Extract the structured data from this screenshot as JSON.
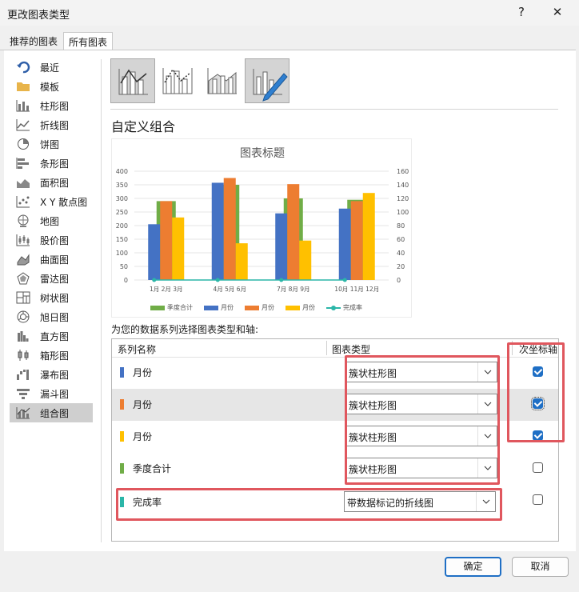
{
  "window": {
    "title": "更改图表类型",
    "help_label": "?",
    "close_label": "✕"
  },
  "tabs": [
    {
      "label": "推荐的图表",
      "active": false
    },
    {
      "label": "所有图表",
      "active": true
    }
  ],
  "sidebar": {
    "items": [
      {
        "label": "最近",
        "icon": "undo-arrow-icon"
      },
      {
        "label": "模板",
        "icon": "folder-icon"
      },
      {
        "label": "柱形图",
        "icon": "column-chart-icon"
      },
      {
        "label": "折线图",
        "icon": "line-chart-icon"
      },
      {
        "label": "饼图",
        "icon": "pie-chart-icon"
      },
      {
        "label": "条形图",
        "icon": "bar-chart-icon"
      },
      {
        "label": "面积图",
        "icon": "area-chart-icon"
      },
      {
        "label": "X Y 散点图",
        "icon": "scatter-chart-icon"
      },
      {
        "label": "地图",
        "icon": "map-chart-icon"
      },
      {
        "label": "股价图",
        "icon": "stock-chart-icon"
      },
      {
        "label": "曲面图",
        "icon": "surface-chart-icon"
      },
      {
        "label": "雷达图",
        "icon": "radar-chart-icon"
      },
      {
        "label": "树状图",
        "icon": "treemap-chart-icon"
      },
      {
        "label": "旭日图",
        "icon": "sunburst-chart-icon"
      },
      {
        "label": "直方图",
        "icon": "histogram-chart-icon"
      },
      {
        "label": "箱形图",
        "icon": "boxwhisker-chart-icon"
      },
      {
        "label": "瀑布图",
        "icon": "waterfall-chart-icon"
      },
      {
        "label": "漏斗图",
        "icon": "funnel-chart-icon"
      },
      {
        "label": "组合图",
        "icon": "combo-chart-icon",
        "selected": true
      }
    ]
  },
  "main": {
    "section_title": "自定义组合",
    "series_caption": "为您的数据系列选择图表类型和轴:",
    "table_headers": {
      "series_name": "系列名称",
      "chart_type": "图表类型",
      "secondary_axis": "次坐标轴"
    },
    "series": [
      {
        "name": "月份",
        "color": "#4472c4",
        "type": "簇状柱形图",
        "secondary": true
      },
      {
        "name": "月份",
        "color": "#ed7d31",
        "type": "簇状柱形图",
        "secondary": true
      },
      {
        "name": "月份",
        "color": "#ffc000",
        "type": "簇状柱形图",
        "secondary": true
      },
      {
        "name": "季度合计",
        "color": "#70ad47",
        "type": "簇状柱形图",
        "secondary": false
      },
      {
        "name": "完成率",
        "color": "#2bb6a8",
        "type": "带数据标记的折线图",
        "secondary": false
      }
    ]
  },
  "footer": {
    "ok_label": "确定",
    "cancel_label": "取消"
  },
  "accent_color": "#1f6fc5",
  "highlight_color": "#e0575e",
  "chart_data": {
    "type": "bar",
    "title": "图表标题",
    "categories": [
      "1月",
      "2月",
      "3月",
      "4月",
      "5月",
      "6月",
      "7月",
      "8月",
      "9月",
      "10月",
      "11月",
      "12月"
    ],
    "x_tick_label_groups": [
      "1月 2月 3月",
      "4月 5月 6月",
      "7月 8月 9月",
      "10月 11月 12月"
    ],
    "quarter_totals": {
      "name": "季度合计",
      "color": "#70ad47",
      "values": [
        290,
        350,
        300,
        295
      ]
    },
    "series": [
      {
        "name": "月份",
        "color": "#4472c4",
        "axis": "secondary",
        "values": [
          82,
          null,
          null,
          143,
          null,
          null,
          98,
          null,
          null,
          105,
          null,
          null
        ]
      },
      {
        "name": "月份",
        "color": "#ed7d31",
        "axis": "secondary",
        "values": [
          null,
          116,
          null,
          null,
          150,
          null,
          null,
          141,
          null,
          null,
          116,
          null
        ]
      },
      {
        "name": "月份",
        "color": "#ffc000",
        "axis": "secondary",
        "values": [
          null,
          null,
          92,
          null,
          null,
          54,
          null,
          null,
          58,
          null,
          null,
          128
        ]
      },
      {
        "name": "完成率",
        "color": "#2bb6a8",
        "type": "line",
        "axis": "secondary",
        "values": [
          0,
          null,
          null,
          0,
          null,
          null,
          0,
          null,
          null,
          0,
          null,
          null
        ]
      }
    ],
    "ylim": [
      0,
      400
    ],
    "yticks": [
      0,
      50,
      100,
      150,
      200,
      250,
      300,
      350,
      400
    ],
    "y2lim": [
      0,
      160
    ],
    "y2ticks": [
      0,
      20,
      40,
      60,
      80,
      100,
      120,
      140,
      160
    ],
    "legend": [
      "季度合计",
      "月份",
      "月份",
      "月份",
      "完成率"
    ],
    "legend_position": "bottom",
    "grid": true
  }
}
